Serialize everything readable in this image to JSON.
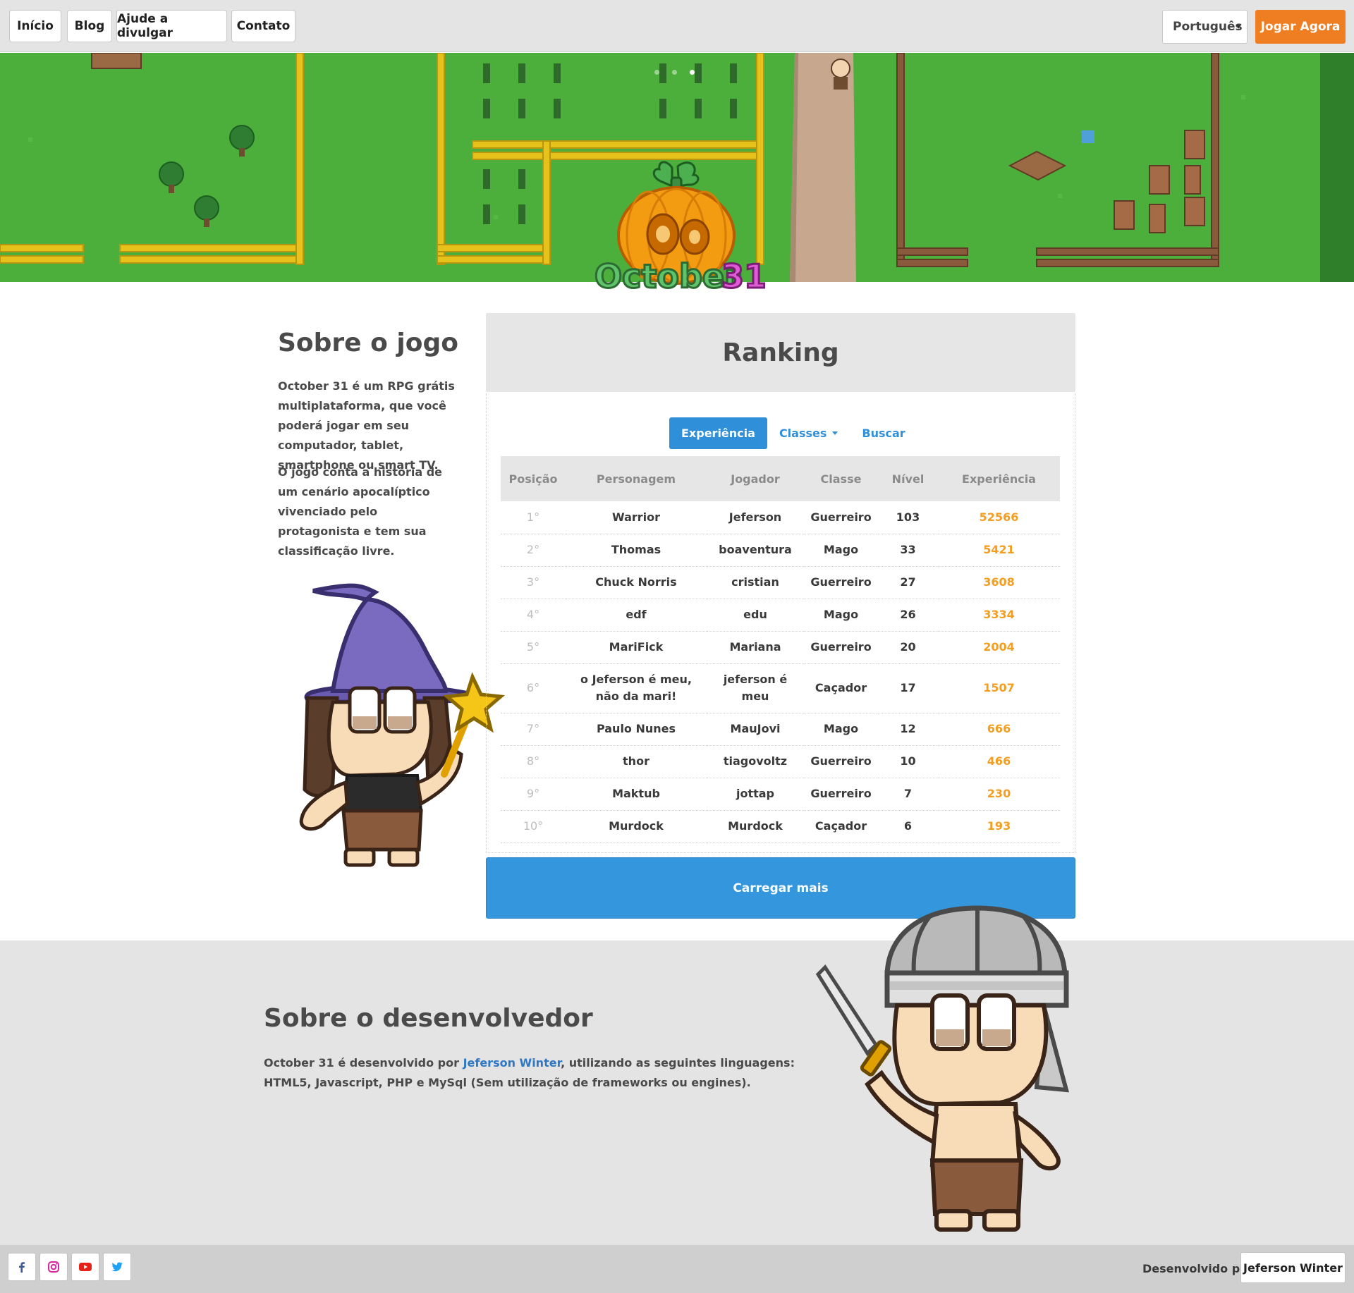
{
  "nav": {
    "home": "Início",
    "blog": "Blog",
    "help": "Ajude a divulgar",
    "contact": "Contato",
    "language": "Português",
    "play": "Jogar Agora"
  },
  "banner": {
    "logo_text": "October31",
    "slide_count": 3,
    "active_slide": 3
  },
  "about": {
    "title": "Sobre o jogo",
    "p1": "October 31 é um RPG grátis multiplataforma, que você poderá jogar em seu computador, tablet, smartphone ou smart TV.",
    "p2": "O jogo conta a história de um cenário apocalíptico vivenciado pelo protagonista e tem sua classificação livre."
  },
  "ranking": {
    "title": "Ranking",
    "tabs": {
      "experience": "Experiência",
      "classes": "Classes",
      "search": "Buscar"
    },
    "columns": {
      "position": "Posição",
      "character": "Personagem",
      "player": "Jogador",
      "class": "Classe",
      "level": "Nível",
      "experience": "Experiência"
    },
    "rows": [
      {
        "pos": "1°",
        "character": "Warrior",
        "player": "Jeferson",
        "class": "Guerreiro",
        "level": "103",
        "xp": "52566"
      },
      {
        "pos": "2°",
        "character": "Thomas",
        "player": "boaventura",
        "class": "Mago",
        "level": "33",
        "xp": "5421"
      },
      {
        "pos": "3°",
        "character": "Chuck Norris",
        "player": "cristian",
        "class": "Guerreiro",
        "level": "27",
        "xp": "3608"
      },
      {
        "pos": "4°",
        "character": "edf",
        "player": "edu",
        "class": "Mago",
        "level": "26",
        "xp": "3334"
      },
      {
        "pos": "5°",
        "character": "MariFick",
        "player": "Mariana",
        "class": "Guerreiro",
        "level": "20",
        "xp": "2004"
      },
      {
        "pos": "6°",
        "character": "o Jeferson é meu, não da mari!",
        "player": "jeferson é meu",
        "class": "Caçador",
        "level": "17",
        "xp": "1507"
      },
      {
        "pos": "7°",
        "character": "Paulo Nunes",
        "player": "MauJovi",
        "class": "Mago",
        "level": "12",
        "xp": "666"
      },
      {
        "pos": "8°",
        "character": "thor",
        "player": "tiagovoltz",
        "class": "Guerreiro",
        "level": "10",
        "xp": "466"
      },
      {
        "pos": "9°",
        "character": "Maktub",
        "player": "jottap",
        "class": "Guerreiro",
        "level": "7",
        "xp": "230"
      },
      {
        "pos": "10°",
        "character": "Murdock",
        "player": "Murdock",
        "class": "Caçador",
        "level": "6",
        "xp": "193"
      }
    ],
    "load_more": "Carregar mais"
  },
  "developer": {
    "title": "Sobre o desenvolvedor",
    "text_before": "October 31 é desenvolvido por ",
    "link": "Jeferson Winter",
    "text_after": ", utilizando as seguintes linguagens: HTML5, Javascript, PHP e MySql (Sem utilização de frameworks ou engines)."
  },
  "footer": {
    "social": [
      "facebook-icon",
      "instagram-icon",
      "youtube-icon",
      "twitter-icon"
    ],
    "developed_by": "Desenvolvido por:",
    "developer_name": "Jeferson Winter"
  },
  "colors": {
    "accent": "#3496dc",
    "play": "#ef7d22",
    "xp": "#f49d1f",
    "grass": "#4caf3c"
  }
}
